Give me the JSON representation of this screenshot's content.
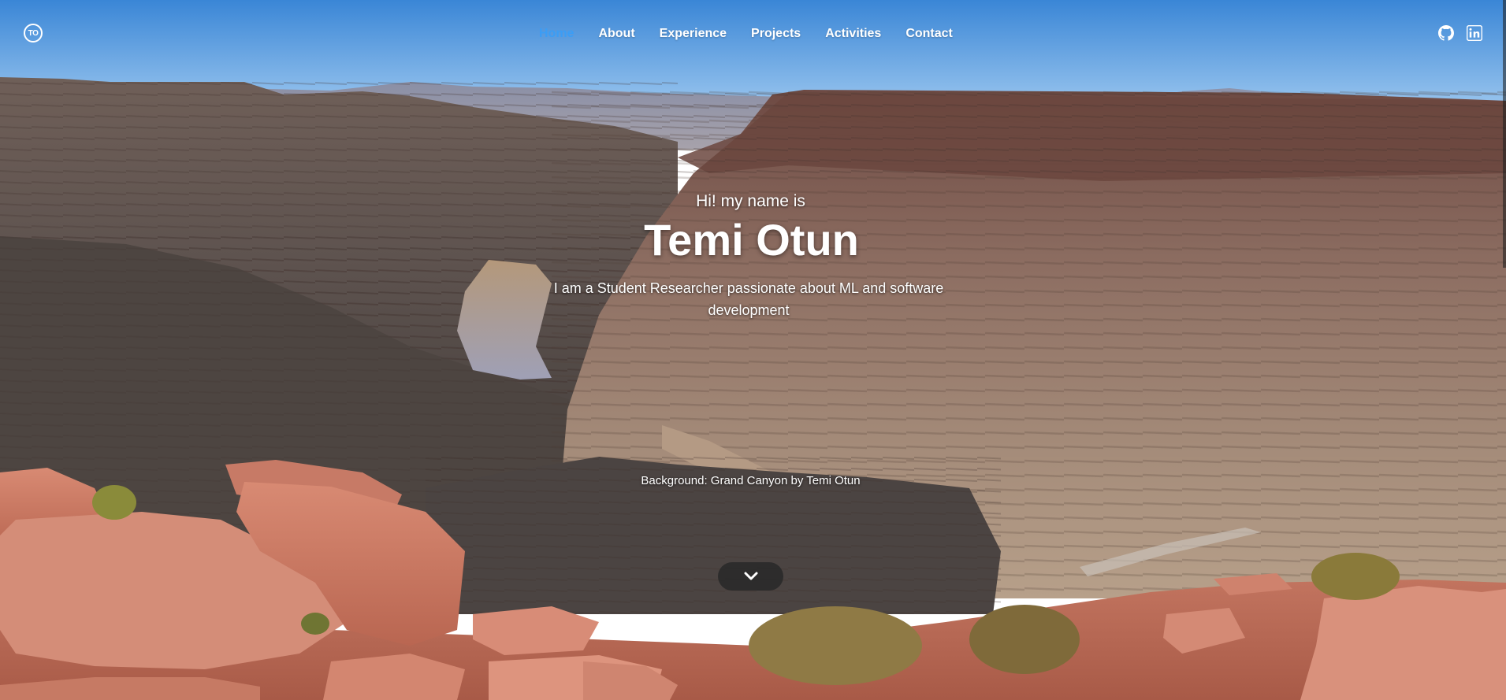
{
  "nav": {
    "logo_text": "TO",
    "items": [
      {
        "label": "Home",
        "active": true
      },
      {
        "label": "About",
        "active": false
      },
      {
        "label": "Experience",
        "active": false
      },
      {
        "label": "Projects",
        "active": false
      },
      {
        "label": "Activities",
        "active": false
      },
      {
        "label": "Contact",
        "active": false
      }
    ],
    "active_color": "#3b9df5",
    "social": [
      {
        "icon": "github-icon"
      },
      {
        "icon": "linkedin-icon"
      }
    ]
  },
  "hero": {
    "greeting": "Hi! my name is",
    "name": "Temi Otun",
    "tagline": "I am a Student Researcher passionate about ML and software development",
    "background_credit": "Background: Grand Canyon by Temi Otun",
    "scroll_icon": "chevron-down-icon"
  }
}
